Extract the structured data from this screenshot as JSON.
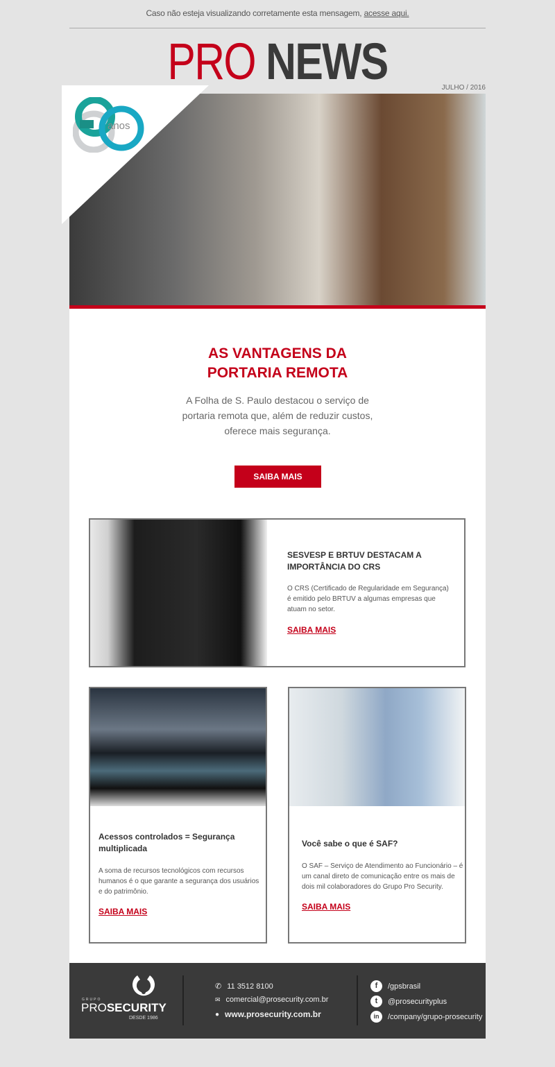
{
  "top_note": {
    "text": "Caso não esteja visualizando corretamente esta mensagem,",
    "link": "acesse aqui."
  },
  "header": {
    "logo_pro": "PRO",
    "logo_news": "NEWS",
    "date": "JULHO / 2016",
    "badge": "anos"
  },
  "colors": {
    "brand_red": "#c4001a",
    "dark": "#3a3a3a",
    "background": "#e4e4e4"
  },
  "hero": {
    "title_line1": "AS VANTAGENS DA",
    "title_line2": "PORTARIA REMOTA",
    "desc_line1": "A Folha de S. Paulo destacou o serviço de",
    "desc_line2": "portaria remota que, além de reduzir custos,",
    "desc_line3": "oferece mais segurança.",
    "button": "SAIBA MAIS"
  },
  "articles": [
    {
      "title_line1": "SESVESP E BRTUV DESTACAM A",
      "title_line2": "IMPORTÂNCIA DO CRS",
      "desc_line1": "O CRS (Certificado de Regularidade em Segurança)",
      "desc_line2": "é emitido pelo BRTUV a algumas empresas que",
      "desc_line3": "atuam no setor.",
      "link": "SAIBA MAIS"
    },
    {
      "title_line1": "Acessos controlados = Segurança",
      "title_line2": "multiplicada",
      "desc_line1": "A soma de recursos tecnológicos com recursos",
      "desc_line2": "humanos é o que garante a segurança dos usuários",
      "desc_line3": "e do patrimônio.",
      "link": "SAIBA MAIS"
    },
    {
      "title_line1": "Você sabe o que é SAF?",
      "desc_line1": "O SAF – Serviço de Atendimento ao Funcionário – é",
      "desc_line2": "um canal direto de comunicação entre os mais de",
      "desc_line3": "dois mil colaboradores do Grupo Pro Security.",
      "link": "SAIBA MAIS"
    }
  ],
  "footer": {
    "brand_grupo": "GRUPO",
    "brand_pro": "PRO",
    "brand_security": "SECURITY",
    "brand_since": "DESDE 1986",
    "phone": "11 3512 8100",
    "email": "comercial@prosecurity.com.br",
    "website": "www.prosecurity.com.br",
    "facebook": "/gpsbrasil",
    "twitter": "@prosecurityplus",
    "linkedin": "/company/grupo-prosecurity"
  }
}
